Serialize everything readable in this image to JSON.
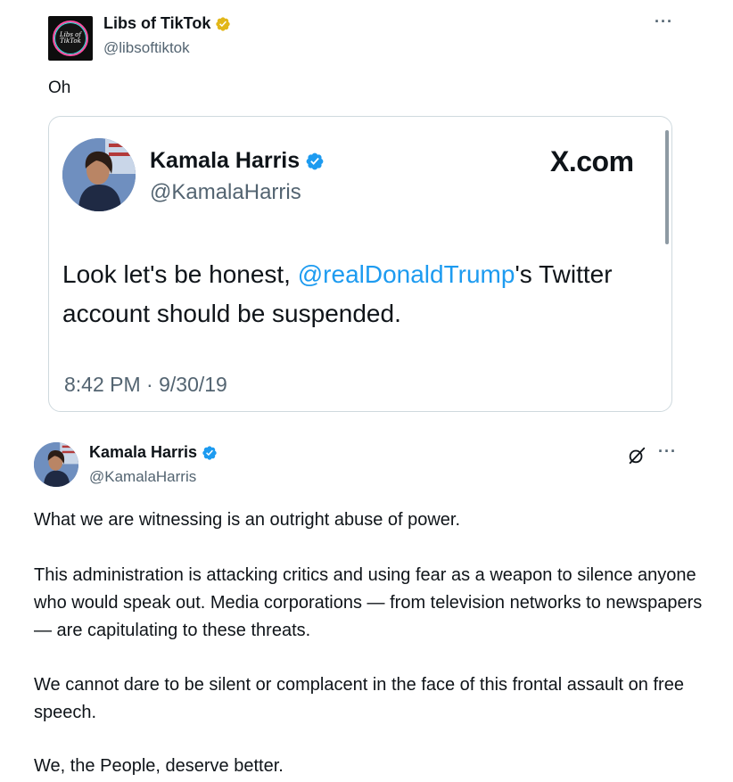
{
  "outer_tweet": {
    "avatar_text_line1": "Libs of",
    "avatar_text_line2": "TikTok",
    "display_name": "Libs of TikTok",
    "handle": "@libsoftiktok",
    "text": "Oh",
    "more_label": "···",
    "verified_icon": "verified-gold-badge"
  },
  "quoted_card": {
    "display_name": "Kamala Harris",
    "handle": "@KamalaHarris",
    "source": "X.com",
    "text_before": "Look let's be honest, ",
    "mention": "@realDonaldTrump",
    "text_after": "'s Twitter account should be suspended.",
    "timestamp": "8:42 PM · 9/30/19",
    "verified_icon": "verified-blue-badge"
  },
  "second_tweet": {
    "display_name": "Kamala Harris",
    "handle": "@KamalaHarris",
    "more_label": "···",
    "grok_icon": "grok-icon",
    "paragraphs": [
      "What we are witnessing is an outright abuse of power.",
      "This administration is attacking critics and using fear as a weapon to silence anyone who would speak out. Media corporations — from television networks to newspapers — are capitulating to these threats.",
      "We cannot dare to be silent or complacent in the face of this frontal assault on free speech.",
      "We, the People, deserve better."
    ]
  },
  "colors": {
    "text_primary": "#0f1419",
    "text_secondary": "#536471",
    "link_blue": "#1d9bf0",
    "verified_gold": "#e2b719",
    "card_border": "#cfd9de"
  }
}
